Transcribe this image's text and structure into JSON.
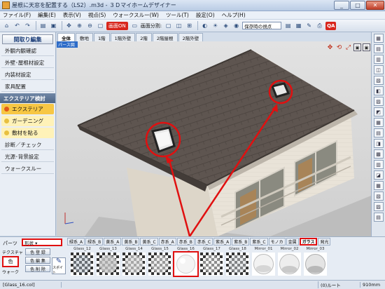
{
  "window": {
    "title": "屋根に天窓を配置する（LS2）.m3d - ３Ｄマイホームデザイナー",
    "minimize": "_",
    "maximize": "□",
    "close": "✕"
  },
  "menu": [
    "ファイル(F)",
    "編集(E)",
    "表示(V)",
    "視点(S)",
    "ウォークスルー(W)",
    "ツール(T)",
    "設定(O)",
    "ヘルプ(H)"
  ],
  "toolbar": {
    "red_button": "画面ON",
    "division_label": "画面分割:",
    "viewpoint_select": "保存時の視点",
    "qa_button": "QA"
  },
  "left_panel": {
    "header": "間取り編集",
    "items": [
      "外観内観確認",
      "外壁･屋根材設定",
      "内装材設定",
      "家具配置"
    ],
    "section": "エクステリア検討",
    "sub_items": [
      "エクステリア",
      "ガーデニング",
      "敷材を貼る"
    ],
    "items2": [
      "診断／チェック",
      "光源･背景設定",
      "ウォークスルー"
    ]
  },
  "floor_tabs": [
    "全体",
    "敷地",
    "1階",
    "1階外壁",
    "2階",
    "2階屋根",
    "2階外壁"
  ],
  "viewport": {
    "label": "パース図",
    "nav_tools": [
      "✥",
      "⟲",
      "⤢",
      "▣",
      "▣"
    ]
  },
  "right_icons": [
    "▦",
    "▤",
    "▥",
    "◫",
    "▧",
    "◧",
    "▨",
    "◩",
    "▦",
    "▤",
    "◨",
    "▩",
    "▥",
    "◪",
    "▦",
    "▧",
    "▨",
    "▤"
  ],
  "bottom": {
    "parts_label": "パーツ",
    "parts_select": "形状 ▾",
    "tex_button": "テクスチャ",
    "color_button": "色",
    "walk_button": "ウォーク",
    "btn_register": "色 登 録",
    "btn_edit": "色 編 集",
    "btn_delete": "色 削 除",
    "spoid_label": "スポイト",
    "category_tabs": [
      "緑系_A",
      "緑系_B",
      "黄系_A",
      "黄系_B",
      "黄系_C",
      "赤系_A",
      "赤系_B",
      "赤系_C",
      "紫系_A",
      "紫系_B",
      "紫系_C",
      "モノカ",
      "金属",
      "ガラス",
      "発光"
    ],
    "active_tab_index": 13,
    "swatches": [
      "Glass_12",
      "Glass_13",
      "Glass_14",
      "Glass_15",
      "Glass_16",
      "Glass_17",
      "Glass_18",
      "Mirror_01",
      "Mirror_02",
      "Mirror_03"
    ],
    "selected_swatch_index": 4
  },
  "status": {
    "left": "[Glass_16.col]",
    "r1": "(0)ルート",
    "r2": "910mm"
  }
}
